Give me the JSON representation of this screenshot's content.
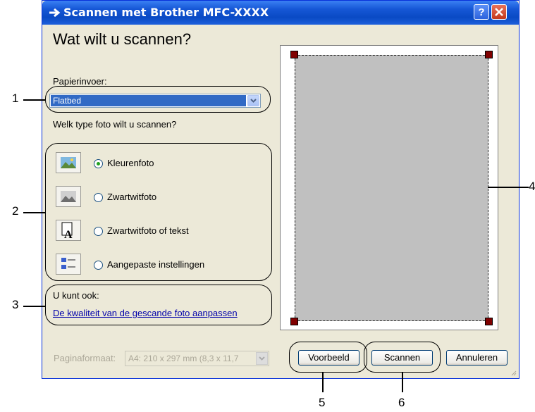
{
  "window": {
    "title": "Scannen met Brother MFC-XXXX",
    "help_label": "?",
    "icons": {
      "title": "scanner-arrow-icon",
      "close": "close-icon"
    }
  },
  "main": {
    "heading": "Wat wilt u scannen?",
    "paper_source_label": "Papierinvoer:",
    "paper_source_value": "Flatbed",
    "photo_type_label": "Welk type foto wilt u scannen?",
    "options": [
      {
        "label": "Kleurenfoto",
        "selected": true
      },
      {
        "label": "Zwartwitfoto",
        "selected": false
      },
      {
        "label": "Zwartwitfoto of tekst",
        "selected": false
      },
      {
        "label": "Aangepaste instellingen",
        "selected": false
      }
    ],
    "also_label": "U kunt ook:",
    "quality_link": "De kwaliteit van de gescande foto aanpassen",
    "page_size_label": "Paginaformaat:",
    "page_size_value": "A4: 210 x 297 mm (8,3 x 11,7"
  },
  "buttons": {
    "preview": "Voorbeeld",
    "scan": "Scannen",
    "cancel": "Annuleren"
  },
  "callouts": [
    "1",
    "2",
    "3",
    "4",
    "5",
    "6"
  ],
  "colors": {
    "titlebar": "#0a4ac4",
    "selection": "#316ac5",
    "link": "#0000aa",
    "preview": "#c0c0c0"
  }
}
